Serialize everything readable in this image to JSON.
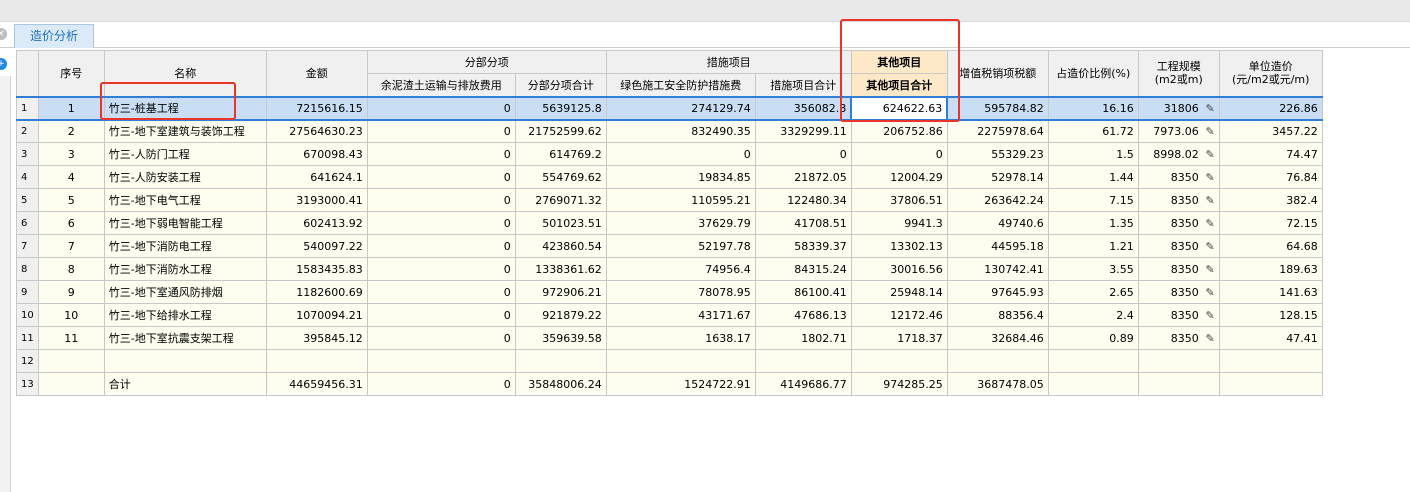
{
  "tab": {
    "label": "造价分析"
  },
  "headers": {
    "seq": "序号",
    "name": "名称",
    "amount": "金额",
    "sub_group": "分部分项",
    "sub_col1": "余泥渣土运输与排放费用",
    "sub_col2": "分部分项合计",
    "measure_group": "措施项目",
    "measure_col1": "绿色施工安全防护措施费",
    "measure_col2": "措施项目合计",
    "other_group": "其他项目",
    "other_col1": "其他项目合计",
    "tax": "增值税销项税额",
    "ratio": "占造价比例(%)",
    "scale": "工程规模",
    "scale_unit": "(m2或m)",
    "unit_cost": "单位造价",
    "unit_cost_unit": "(元/m2或元/m)"
  },
  "rows": [
    {
      "rn": "1",
      "seq": "1",
      "name": "竹三-桩基工程",
      "amount": "7215616.15",
      "sub1": "0",
      "sub2": "5639125.8",
      "m1": "274129.74",
      "m2": "356082.8",
      "other": "624622.63",
      "tax": "595784.82",
      "ratio": "16.16",
      "scale": "31806",
      "unit": "226.86"
    },
    {
      "rn": "2",
      "seq": "2",
      "name": "竹三-地下室建筑与装饰工程",
      "amount": "27564630.23",
      "sub1": "0",
      "sub2": "21752599.62",
      "m1": "832490.35",
      "m2": "3329299.11",
      "other": "206752.86",
      "tax": "2275978.64",
      "ratio": "61.72",
      "scale": "7973.06",
      "unit": "3457.22"
    },
    {
      "rn": "3",
      "seq": "3",
      "name": "竹三-人防门工程",
      "amount": "670098.43",
      "sub1": "0",
      "sub2": "614769.2",
      "m1": "0",
      "m2": "0",
      "other": "0",
      "tax": "55329.23",
      "ratio": "1.5",
      "scale": "8998.02",
      "unit": "74.47"
    },
    {
      "rn": "4",
      "seq": "4",
      "name": "竹三-人防安装工程",
      "amount": "641624.1",
      "sub1": "0",
      "sub2": "554769.62",
      "m1": "19834.85",
      "m2": "21872.05",
      "other": "12004.29",
      "tax": "52978.14",
      "ratio": "1.44",
      "scale": "8350",
      "unit": "76.84"
    },
    {
      "rn": "5",
      "seq": "5",
      "name": "竹三-地下电气工程",
      "amount": "3193000.41",
      "sub1": "0",
      "sub2": "2769071.32",
      "m1": "110595.21",
      "m2": "122480.34",
      "other": "37806.51",
      "tax": "263642.24",
      "ratio": "7.15",
      "scale": "8350",
      "unit": "382.4"
    },
    {
      "rn": "6",
      "seq": "6",
      "name": "竹三-地下弱电智能工程",
      "amount": "602413.92",
      "sub1": "0",
      "sub2": "501023.51",
      "m1": "37629.79",
      "m2": "41708.51",
      "other": "9941.3",
      "tax": "49740.6",
      "ratio": "1.35",
      "scale": "8350",
      "unit": "72.15"
    },
    {
      "rn": "7",
      "seq": "7",
      "name": "竹三-地下消防电工程",
      "amount": "540097.22",
      "sub1": "0",
      "sub2": "423860.54",
      "m1": "52197.78",
      "m2": "58339.37",
      "other": "13302.13",
      "tax": "44595.18",
      "ratio": "1.21",
      "scale": "8350",
      "unit": "64.68"
    },
    {
      "rn": "8",
      "seq": "8",
      "name": "竹三-地下消防水工程",
      "amount": "1583435.83",
      "sub1": "0",
      "sub2": "1338361.62",
      "m1": "74956.4",
      "m2": "84315.24",
      "other": "30016.56",
      "tax": "130742.41",
      "ratio": "3.55",
      "scale": "8350",
      "unit": "189.63"
    },
    {
      "rn": "9",
      "seq": "9",
      "name": "竹三-地下室通风防排烟",
      "amount": "1182600.69",
      "sub1": "0",
      "sub2": "972906.21",
      "m1": "78078.95",
      "m2": "86100.41",
      "other": "25948.14",
      "tax": "97645.93",
      "ratio": "2.65",
      "scale": "8350",
      "unit": "141.63"
    },
    {
      "rn": "10",
      "seq": "10",
      "name": "竹三-地下给排水工程",
      "amount": "1070094.21",
      "sub1": "0",
      "sub2": "921879.22",
      "m1": "43171.67",
      "m2": "47686.13",
      "other": "12172.46",
      "tax": "88356.4",
      "ratio": "2.4",
      "scale": "8350",
      "unit": "128.15"
    },
    {
      "rn": "11",
      "seq": "11",
      "name": "竹三-地下室抗震支架工程",
      "amount": "395845.12",
      "sub1": "0",
      "sub2": "359639.58",
      "m1": "1638.17",
      "m2": "1802.71",
      "other": "1718.37",
      "tax": "32684.46",
      "ratio": "0.89",
      "scale": "8350",
      "unit": "47.41"
    },
    {
      "rn": "12",
      "seq": "",
      "name": "",
      "amount": "",
      "sub1": "",
      "sub2": "",
      "m1": "",
      "m2": "",
      "other": "",
      "tax": "",
      "ratio": "",
      "scale": "",
      "unit": ""
    },
    {
      "rn": "13",
      "seq": "",
      "name": "合计",
      "amount": "44659456.31",
      "sub1": "0",
      "sub2": "35848006.24",
      "m1": "1524722.91",
      "m2": "4149686.77",
      "other": "974285.25",
      "tax": "3687478.05",
      "ratio": "",
      "scale": "",
      "unit": ""
    }
  ],
  "edit_icon": "pencil-icon",
  "colors": {
    "selection": "#c9def5",
    "highlight_box": "#e8342b",
    "other_header": "#fde8c8",
    "tab_text": "#1b6fc4"
  }
}
